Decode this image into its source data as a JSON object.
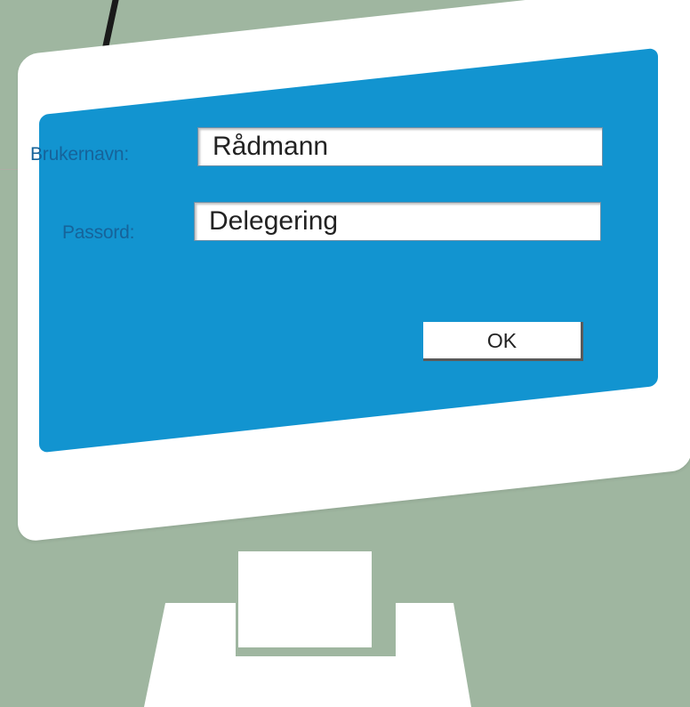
{
  "login_form": {
    "username_label": "Brukernavn:",
    "username_value": "Rådmann",
    "password_label": "Passord:",
    "password_value": "Delegering",
    "ok_label": "OK"
  },
  "colors": {
    "background": "#9fb6a0",
    "screen": "#1294d0",
    "monitor_frame": "#ffffff",
    "label_text": "#16639a"
  },
  "icons": [
    "pen-icon",
    "monitor-stand"
  ]
}
